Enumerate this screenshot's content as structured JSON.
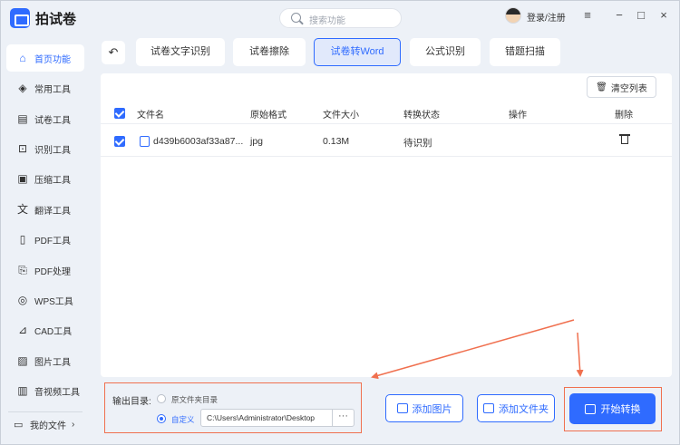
{
  "app": {
    "title": "拍试卷",
    "search_placeholder": "搜索功能",
    "login": "登录/注册"
  },
  "window_controls": {
    "menu": "≡",
    "minimize": "−",
    "maximize": "□",
    "close": "×"
  },
  "sidebar": {
    "items": [
      {
        "label": "首页功能",
        "icon": "home-icon",
        "active": true
      },
      {
        "label": "常用工具",
        "icon": "layers-icon"
      },
      {
        "label": "试卷工具",
        "icon": "paper-icon"
      },
      {
        "label": "识别工具",
        "icon": "scan-icon"
      },
      {
        "label": "压缩工具",
        "icon": "compress-icon"
      },
      {
        "label": "翻译工具",
        "icon": "translate-icon"
      },
      {
        "label": "PDF工具",
        "icon": "pdf-icon"
      },
      {
        "label": "PDF处理",
        "icon": "pdf-process-icon"
      },
      {
        "label": "WPS工具",
        "icon": "wps-icon"
      },
      {
        "label": "CAD工具",
        "icon": "cad-icon"
      },
      {
        "label": "图片工具",
        "icon": "image-icon"
      },
      {
        "label": "音视频工具",
        "icon": "video-icon"
      }
    ],
    "my_files": "我的文件"
  },
  "tabs": [
    {
      "label": "试卷文字识别"
    },
    {
      "label": "试卷擦除"
    },
    {
      "label": "试卷转Word",
      "active": true
    },
    {
      "label": "公式识别"
    },
    {
      "label": "错题扫描"
    }
  ],
  "toolbar": {
    "clear_label": "清空列表"
  },
  "table": {
    "headers": [
      "文件名",
      "原始格式",
      "文件大小",
      "转换状态",
      "操作",
      "删除"
    ],
    "rows": [
      {
        "name": "d439b6003af33a87...",
        "format": "jpg",
        "size": "0.13M",
        "status": "待识别"
      }
    ]
  },
  "output": {
    "label": "输出目录:",
    "option_original": "原文件夹目录",
    "option_custom": "自定义",
    "path": "C:\\Users\\Administrator\\Desktop",
    "more": "···"
  },
  "actions": {
    "add_image": "添加图片",
    "add_folder": "添加文件夹",
    "start": "开始转换"
  },
  "colors": {
    "accent": "#2f6bff",
    "annotation": "#f0704f"
  }
}
